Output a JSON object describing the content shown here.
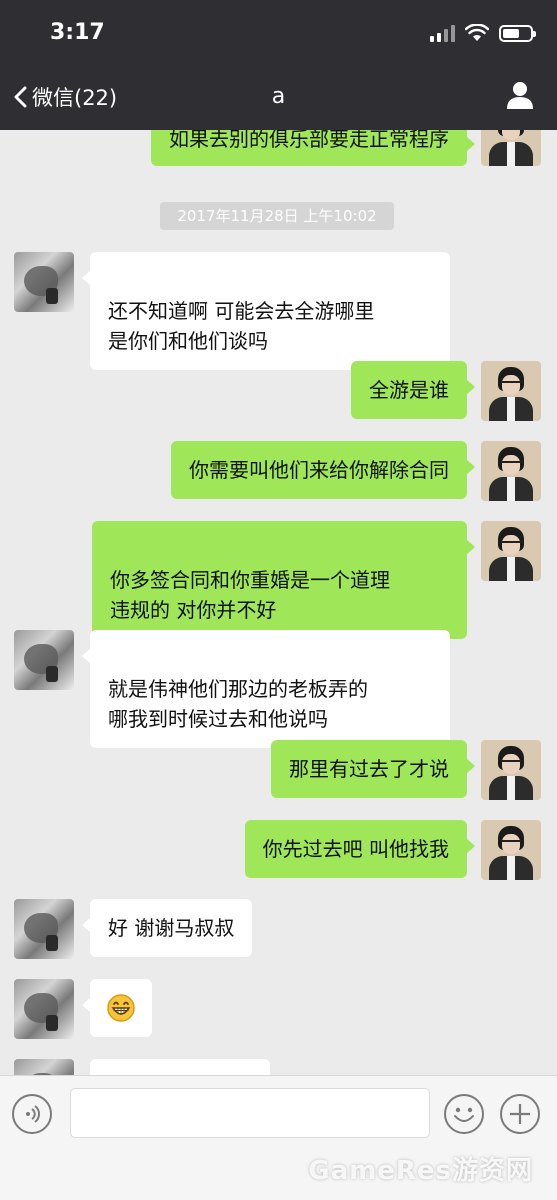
{
  "status_bar": {
    "time": "3:17"
  },
  "nav": {
    "back_label": "微信(22)",
    "title": "a"
  },
  "timestamp": "2017年11月28日 上午10:02",
  "messages": [
    {
      "side": "right",
      "text": "如果去别的俱乐部要走正常程序"
    },
    {
      "side": "left",
      "text": "还不知道啊 可能会去全游哪里\n是你们和他们谈吗"
    },
    {
      "side": "right",
      "text": "全游是谁"
    },
    {
      "side": "right",
      "text": "你需要叫他们来给你解除合同"
    },
    {
      "side": "right",
      "text": "你多签合同和你重婚是一个道理\n违规的 对你并不好"
    },
    {
      "side": "left",
      "text": "就是伟神他们那边的老板弄的\n哪我到时候过去和他说吗"
    },
    {
      "side": "right",
      "text": "那里有过去了才说"
    },
    {
      "side": "right",
      "text": "你先过去吧 叫他找我"
    },
    {
      "side": "left",
      "text": "好 谢谢马叔叔"
    },
    {
      "side": "left",
      "emoji": "grinning-face-emoji"
    },
    {
      "side": "left",
      "text": ""
    }
  ],
  "input_bar": {
    "placeholder": "",
    "watermark": "GameRes游资网"
  },
  "colors": {
    "nav_bg": "#2f2f33",
    "chat_bg": "#ebebeb",
    "sent_bubble": "#9fe658",
    "received_bubble": "#ffffff"
  },
  "icons": [
    "chevron-left-icon",
    "profile-icon",
    "signal-icon",
    "wifi-icon",
    "battery-icon",
    "voice-icon",
    "emoji-icon",
    "plus-icon"
  ]
}
